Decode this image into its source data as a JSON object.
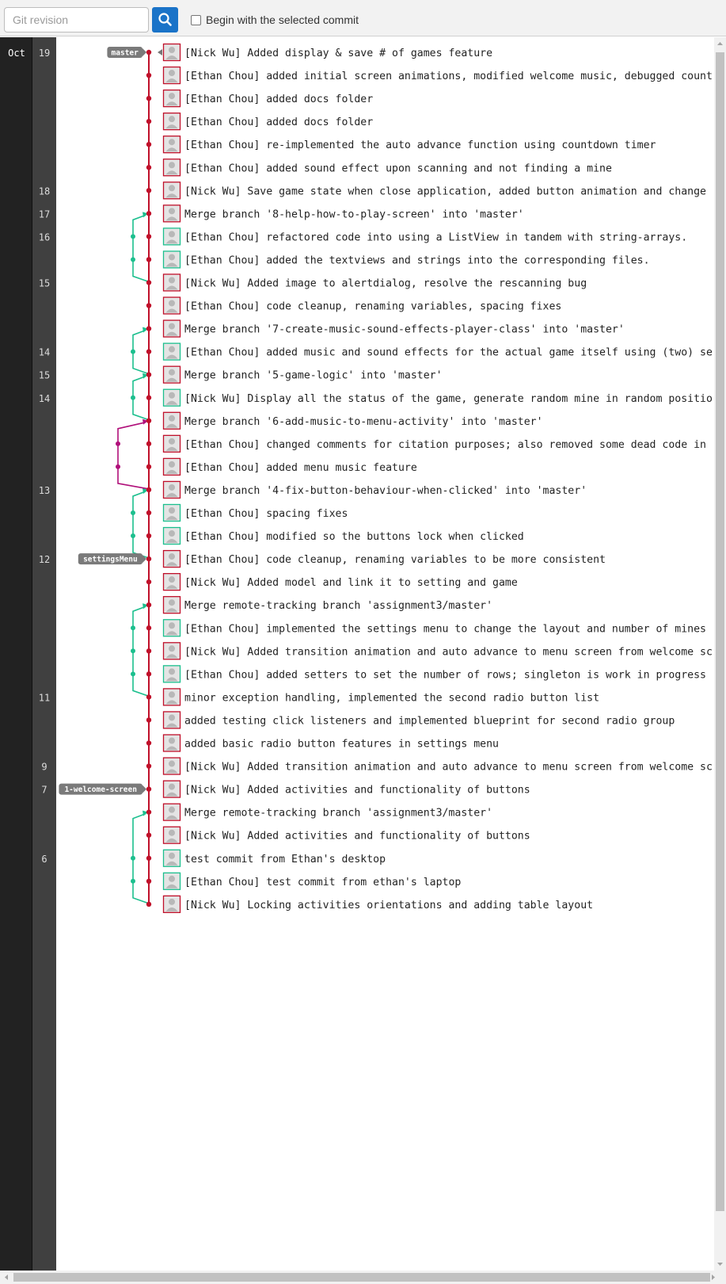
{
  "toolbar": {
    "revision_placeholder": "Git revision",
    "search_icon": "search-icon",
    "checkbox_label": "Begin with the selected commit",
    "checkbox_checked": false
  },
  "colors": {
    "master_line": "#c0102a",
    "branch_teal": "#1cbf8e",
    "branch_magenta": "#b0107a",
    "search_button": "#1a73c8",
    "label_bg": "#7a7a7a"
  },
  "commits": [
    {
      "month": "Oct",
      "day": "19",
      "label": "master",
      "msg": "[Nick Wu] Added display & save # of games feature",
      "avatar": "red"
    },
    {
      "month": "",
      "day": "",
      "label": "",
      "msg": "[Ethan Chou] added initial screen animations, modified welcome music, debugged countdown",
      "avatar": "red"
    },
    {
      "month": "",
      "day": "",
      "label": "",
      "msg": "[Ethan Chou] added docs folder",
      "avatar": "red"
    },
    {
      "month": "",
      "day": "",
      "label": "",
      "msg": "[Ethan Chou] added docs folder",
      "avatar": "red"
    },
    {
      "month": "",
      "day": "",
      "label": "",
      "msg": "[Ethan Chou] re-implemented the auto advance function using countdown timer",
      "avatar": "red"
    },
    {
      "month": "",
      "day": "",
      "label": "",
      "msg": "[Ethan Chou] added sound effect upon scanning and not finding a mine",
      "avatar": "red"
    },
    {
      "month": "",
      "day": "18",
      "label": "",
      "msg": "[Nick Wu] Save game state when close application, added button animation and change how",
      "avatar": "red"
    },
    {
      "month": "",
      "day": "17",
      "label": "",
      "msg": "Merge branch '8-help-how-to-play-screen' into 'master'",
      "avatar": "red"
    },
    {
      "month": "",
      "day": "16",
      "label": "",
      "msg": "[Ethan Chou] refactored code into using a ListView in tandem with string-arrays.",
      "avatar": "teal"
    },
    {
      "month": "",
      "day": "",
      "label": "",
      "msg": "[Ethan Chou] added the textviews and strings into the corresponding files.",
      "avatar": "teal"
    },
    {
      "month": "",
      "day": "15",
      "label": "",
      "msg": "[Nick Wu] Added image to alertdialog, resolve the rescanning bug",
      "avatar": "red"
    },
    {
      "month": "",
      "day": "",
      "label": "",
      "msg": "[Ethan Chou] code cleanup, renaming variables, spacing fixes",
      "avatar": "red"
    },
    {
      "month": "",
      "day": "",
      "label": "",
      "msg": "Merge branch '7-create-music-sound-effects-player-class' into 'master'",
      "avatar": "red"
    },
    {
      "month": "",
      "day": "14",
      "label": "",
      "msg": "[Ethan Chou] added music and sound effects for the actual game itself using (two) separ",
      "avatar": "teal"
    },
    {
      "month": "",
      "day": "15",
      "label": "",
      "msg": "Merge branch '5-game-logic' into 'master'",
      "avatar": "red"
    },
    {
      "month": "",
      "day": "14",
      "label": "",
      "msg": "[Nick Wu] Display all the status of the game, generate random mine in random position, ",
      "avatar": "teal"
    },
    {
      "month": "",
      "day": "",
      "label": "",
      "msg": "Merge branch '6-add-music-to-menu-activity' into 'master'",
      "avatar": "red"
    },
    {
      "month": "",
      "day": "",
      "label": "",
      "msg": "[Ethan Chou] changed comments for citation purposes; also removed some dead code in the",
      "avatar": "red"
    },
    {
      "month": "",
      "day": "",
      "label": "",
      "msg": "[Ethan Chou] added menu music feature",
      "avatar": "red"
    },
    {
      "month": "",
      "day": "13",
      "label": "",
      "msg": "Merge branch '4-fix-button-behaviour-when-clicked' into 'master'",
      "avatar": "red"
    },
    {
      "month": "",
      "day": "",
      "label": "",
      "msg": "[Ethan Chou] spacing fixes",
      "avatar": "teal"
    },
    {
      "month": "",
      "day": "",
      "label": "",
      "msg": "[Ethan Chou] modified so the buttons lock when clicked",
      "avatar": "teal"
    },
    {
      "month": "",
      "day": "12",
      "label": "settingsMenu",
      "msg": "[Ethan Chou] code cleanup, renaming variables to be more consistent",
      "avatar": "red"
    },
    {
      "month": "",
      "day": "",
      "label": "",
      "msg": "[Nick Wu] Added model and link it to setting and game",
      "avatar": "red"
    },
    {
      "month": "",
      "day": "",
      "label": "",
      "msg": "Merge remote-tracking branch 'assignment3/master'",
      "avatar": "red"
    },
    {
      "month": "",
      "day": "",
      "label": "",
      "msg": "[Ethan Chou] implemented the settings menu to change the layout and number of mines",
      "avatar": "teal"
    },
    {
      "month": "",
      "day": "",
      "label": "",
      "msg": "[Nick Wu] Added transition animation and auto advance to menu screen from welcome scree",
      "avatar": "red"
    },
    {
      "month": "",
      "day": "",
      "label": "",
      "msg": "[Ethan Chou] added setters to set the number of rows; singleton is work in progress",
      "avatar": "teal"
    },
    {
      "month": "",
      "day": "11",
      "label": "",
      "msg": "minor exception handling, implemented the second radio button list",
      "avatar": "red"
    },
    {
      "month": "",
      "day": "",
      "label": "",
      "msg": "added testing click listeners and implemented blueprint for second radio group",
      "avatar": "red"
    },
    {
      "month": "",
      "day": "",
      "label": "",
      "msg": "added basic radio button features in settings menu",
      "avatar": "red"
    },
    {
      "month": "",
      "day": "9",
      "label": "",
      "msg": "[Nick Wu] Added transition animation and auto advance to menu screen from welcome scree",
      "avatar": "red"
    },
    {
      "month": "",
      "day": "7",
      "label": "1-welcome-screen",
      "msg": "[Nick Wu] Added activities and functionality of buttons",
      "avatar": "red"
    },
    {
      "month": "",
      "day": "",
      "label": "",
      "msg": "Merge remote-tracking branch 'assignment3/master'",
      "avatar": "red"
    },
    {
      "month": "",
      "day": "",
      "label": "",
      "msg": "[Nick Wu] Added activities and functionality of buttons",
      "avatar": "red"
    },
    {
      "month": "",
      "day": "6",
      "label": "",
      "msg": "test commit from Ethan's desktop",
      "avatar": "teal"
    },
    {
      "month": "",
      "day": "",
      "label": "",
      "msg": "[Ethan Chou] test commit from ethan's laptop",
      "avatar": "teal"
    },
    {
      "month": "",
      "day": "",
      "label": "",
      "msg": "[Nick Wu] Locking activities orientations and adding table layout",
      "avatar": "red"
    }
  ]
}
